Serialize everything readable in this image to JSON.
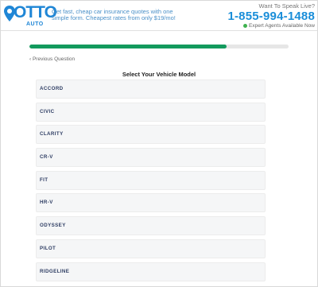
{
  "brand": {
    "logo_word": "OTTO",
    "logo_sub": "AUTO",
    "tagline": "Get fast, cheap car insurance quotes with one simple form. Cheapest rates from only $19/mo!"
  },
  "contact": {
    "question": "Want To Speak Live?",
    "phone": "1-855-994-1488",
    "status": "Expert Agents Available Now"
  },
  "progress": {
    "fraction": 0.76
  },
  "nav": {
    "previous_label": "‹ Previous Question"
  },
  "question": {
    "title": "Select Your Vehicle Model"
  },
  "options": [
    "ACCORD",
    "CIVIC",
    "CLARITY",
    "CR-V",
    "FIT",
    "HR-V",
    "ODYSSEY",
    "PILOT",
    "RIDGELINE"
  ],
  "colors": {
    "brand_blue": "#1f86d6",
    "progress_green": "#139a5d",
    "status_green": "#3fb24f"
  }
}
